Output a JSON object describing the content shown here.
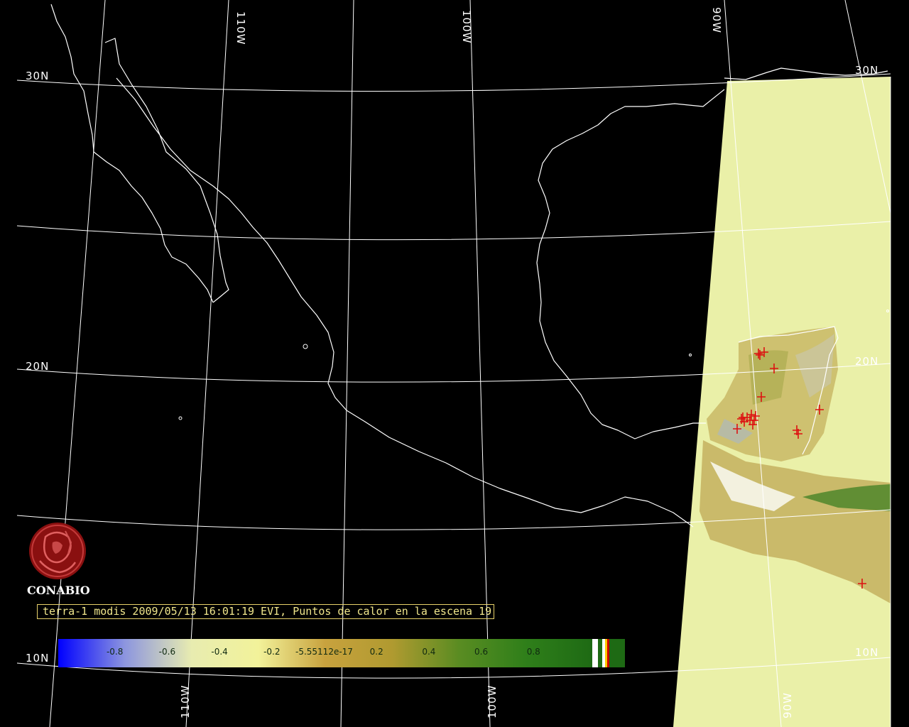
{
  "map": {
    "colors": {
      "background": "#000000",
      "gridline": "#ffffff",
      "coastline": "#ffffff",
      "swath_fill": "#eaf0a8",
      "hotspot_marker": "#dd1111",
      "caption_text": "#f0e68c"
    },
    "grid_labels": {
      "lat_30n_left": "30N",
      "lat_30n_right": "30N",
      "lat_20n_left": "20N",
      "lat_20n_right": "20N",
      "lat_10n_left": "10N",
      "lat_10n_right": "10N",
      "lon_110w_top": "110W",
      "lon_100w_top": "100W",
      "lon_90w_top": "90W",
      "lon_110w_bottom": "110W",
      "lon_100w_bottom": "100W",
      "lon_90w_bottom": "90W"
    },
    "hotspot_count": 19,
    "hotspot_marker_icon": "cross-marker-icon"
  },
  "logo": {
    "icon": "conabio-seal-icon",
    "text": "CONABIO"
  },
  "caption": {
    "text": "terra-1 modis 2009/05/13 16:01:19 EVI, Puntos de calor en la escena 19"
  },
  "colorbar": {
    "label_color": "#102a10",
    "ticks": [
      {
        "value": -0.8,
        "label": "-0.8"
      },
      {
        "value": -0.6,
        "label": "-0.6"
      },
      {
        "value": -0.4,
        "label": "-0.4"
      },
      {
        "value": -0.2,
        "label": "-0.2"
      },
      {
        "value": 0.0,
        "label": "-5.55112e-17"
      },
      {
        "value": 0.2,
        "label": "0.2"
      },
      {
        "value": 0.4,
        "label": "0.4"
      },
      {
        "value": 0.6,
        "label": "0.6"
      },
      {
        "value": 0.8,
        "label": "0.8"
      }
    ],
    "gradient_stops": [
      "#0000ff",
      "#8d96df",
      "#e8ecb0",
      "#f2f29a",
      "#c8a23e",
      "#b09a30",
      "#5a8c22",
      "#2f7f1a",
      "#1e6a14"
    ],
    "end_swatches": [
      "#ffffff",
      "#1e6a14",
      "#ffffff",
      "#ffcc00",
      "#cc0000",
      "#1e6a14"
    ]
  }
}
